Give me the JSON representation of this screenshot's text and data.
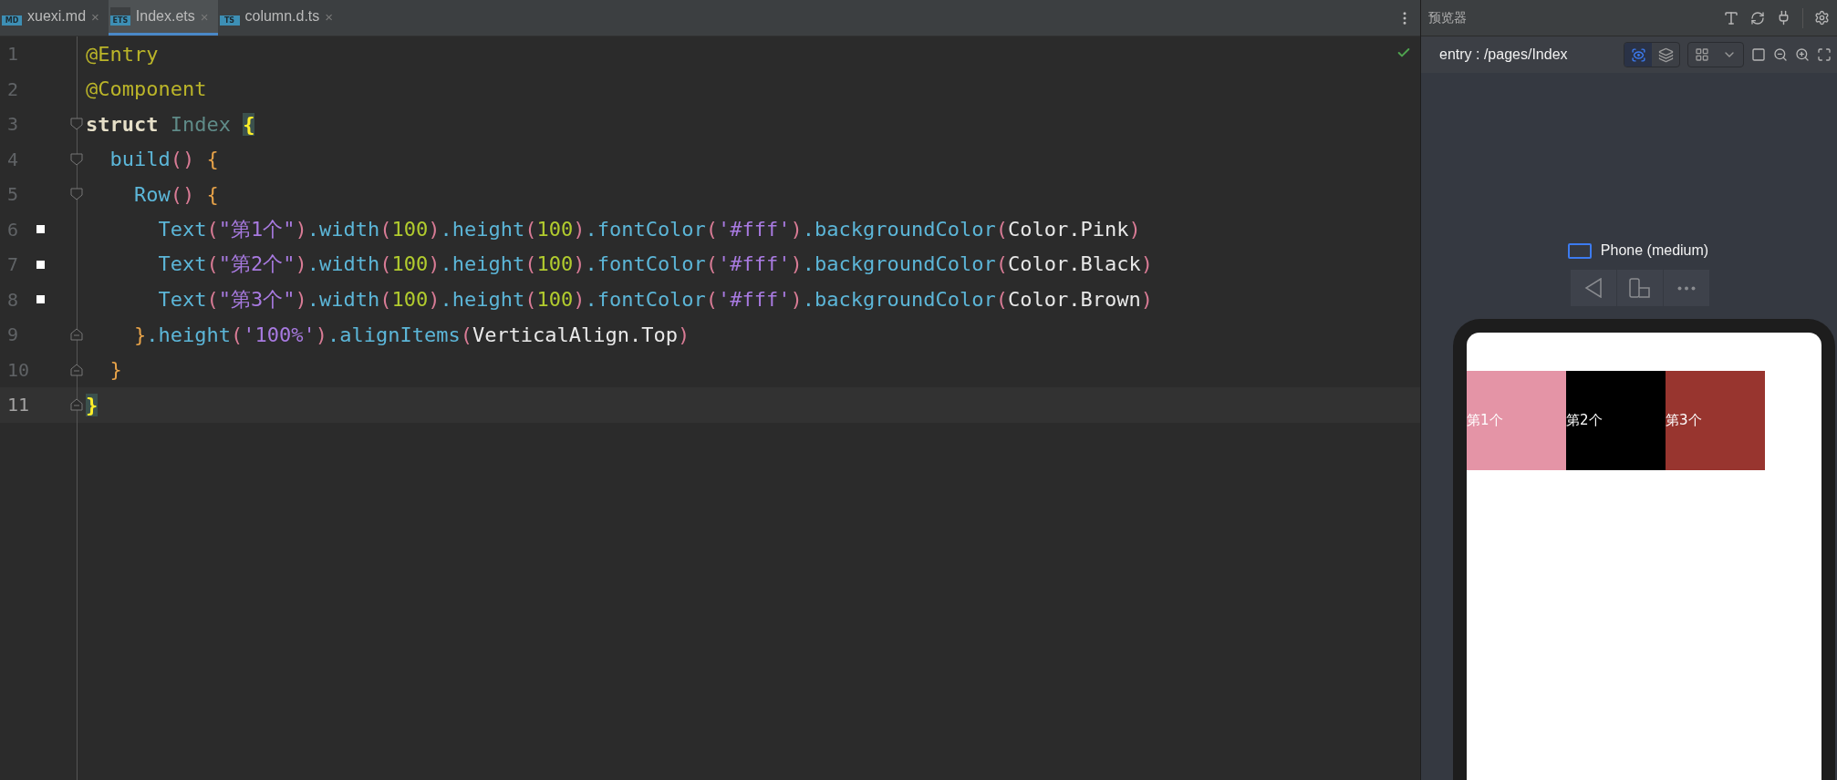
{
  "tabs": [
    {
      "label": "xuexi.md",
      "icon_label": "MD",
      "close": "×",
      "selected": false
    },
    {
      "label": "Index.ets",
      "icon_label": "ETS",
      "close": "×",
      "selected": true
    },
    {
      "label": "column.d.ts",
      "icon_label": "TS",
      "close": "×",
      "selected": false
    }
  ],
  "editor": {
    "lines": [
      {
        "number": "1",
        "changed": false,
        "kind": "plain",
        "current": false,
        "tokens": [
          {
            "kind": "annotation",
            "text": "@Entry"
          }
        ]
      },
      {
        "number": "2",
        "changed": false,
        "kind": "plain",
        "current": false,
        "tokens": [
          {
            "kind": "annotation",
            "text": "@Component"
          }
        ]
      },
      {
        "number": "3",
        "changed": false,
        "kind": "fold_start",
        "current": false,
        "tokens": [
          {
            "kind": "keyword",
            "text": "struct"
          },
          {
            "kind": "type",
            "text": " Index "
          },
          {
            "kind": "match",
            "text": "{"
          }
        ]
      },
      {
        "number": "4",
        "changed": false,
        "kind": "fold_start",
        "current": false,
        "tokens": [
          {
            "kind": "call",
            "text": "  build"
          },
          {
            "kind": "paren",
            "text": "()"
          },
          {
            "kind": "brace",
            "text": " {"
          }
        ]
      },
      {
        "number": "5",
        "changed": false,
        "kind": "fold_start",
        "current": false,
        "tokens": [
          {
            "kind": "call",
            "text": "    Row"
          },
          {
            "kind": "paren",
            "text": "()"
          },
          {
            "kind": "brace",
            "text": " {"
          }
        ]
      },
      {
        "number": "6",
        "changed": true,
        "kind": "plain",
        "current": false,
        "tokens": [
          {
            "kind": "call",
            "text": "      Text"
          },
          {
            "kind": "paren",
            "text": "("
          },
          {
            "kind": "string",
            "text": "\"第1个\""
          },
          {
            "kind": "paren",
            "text": ")"
          },
          {
            "kind": "call",
            "text": ".width"
          },
          {
            "kind": "paren",
            "text": "("
          },
          {
            "kind": "number",
            "text": "100"
          },
          {
            "kind": "paren",
            "text": ")"
          },
          {
            "kind": "call",
            "text": ".height"
          },
          {
            "kind": "paren",
            "text": "("
          },
          {
            "kind": "number",
            "text": "100"
          },
          {
            "kind": "paren",
            "text": ")"
          },
          {
            "kind": "call",
            "text": ".fontColor"
          },
          {
            "kind": "paren",
            "text": "("
          },
          {
            "kind": "string",
            "text": "'#fff'"
          },
          {
            "kind": "paren",
            "text": ")"
          },
          {
            "kind": "call",
            "text": ".backgroundColor"
          },
          {
            "kind": "paren",
            "text": "("
          },
          {
            "kind": "plain",
            "text": "Color.Pink"
          },
          {
            "kind": "paren",
            "text": ")"
          }
        ]
      },
      {
        "number": "7",
        "changed": true,
        "kind": "plain",
        "current": false,
        "tokens": [
          {
            "kind": "call",
            "text": "      Text"
          },
          {
            "kind": "paren",
            "text": "("
          },
          {
            "kind": "string",
            "text": "\"第2个\""
          },
          {
            "kind": "paren",
            "text": ")"
          },
          {
            "kind": "call",
            "text": ".width"
          },
          {
            "kind": "paren",
            "text": "("
          },
          {
            "kind": "number",
            "text": "100"
          },
          {
            "kind": "paren",
            "text": ")"
          },
          {
            "kind": "call",
            "text": ".height"
          },
          {
            "kind": "paren",
            "text": "("
          },
          {
            "kind": "number",
            "text": "100"
          },
          {
            "kind": "paren",
            "text": ")"
          },
          {
            "kind": "call",
            "text": ".fontColor"
          },
          {
            "kind": "paren",
            "text": "("
          },
          {
            "kind": "string",
            "text": "'#fff'"
          },
          {
            "kind": "paren",
            "text": ")"
          },
          {
            "kind": "call",
            "text": ".backgroundColor"
          },
          {
            "kind": "paren",
            "text": "("
          },
          {
            "kind": "plain",
            "text": "Color.Black"
          },
          {
            "kind": "paren",
            "text": ")"
          }
        ]
      },
      {
        "number": "8",
        "changed": true,
        "kind": "plain",
        "current": false,
        "tokens": [
          {
            "kind": "call",
            "text": "      Text"
          },
          {
            "kind": "paren",
            "text": "("
          },
          {
            "kind": "string",
            "text": "\"第3个\""
          },
          {
            "kind": "paren",
            "text": ")"
          },
          {
            "kind": "call",
            "text": ".width"
          },
          {
            "kind": "paren",
            "text": "("
          },
          {
            "kind": "number",
            "text": "100"
          },
          {
            "kind": "paren",
            "text": ")"
          },
          {
            "kind": "call",
            "text": ".height"
          },
          {
            "kind": "paren",
            "text": "("
          },
          {
            "kind": "number",
            "text": "100"
          },
          {
            "kind": "paren",
            "text": ")"
          },
          {
            "kind": "call",
            "text": ".fontColor"
          },
          {
            "kind": "paren",
            "text": "("
          },
          {
            "kind": "string",
            "text": "'#fff'"
          },
          {
            "kind": "paren",
            "text": ")"
          },
          {
            "kind": "call",
            "text": ".backgroundColor"
          },
          {
            "kind": "paren",
            "text": "("
          },
          {
            "kind": "plain",
            "text": "Color.Brown"
          },
          {
            "kind": "paren",
            "text": ")"
          }
        ]
      },
      {
        "number": "9",
        "changed": false,
        "kind": "fold_end",
        "current": false,
        "tokens": [
          {
            "kind": "brace",
            "text": "    }"
          },
          {
            "kind": "call",
            "text": ".height"
          },
          {
            "kind": "paren",
            "text": "("
          },
          {
            "kind": "string",
            "text": "'100%'"
          },
          {
            "kind": "paren",
            "text": ")"
          },
          {
            "kind": "call",
            "text": ".alignItems"
          },
          {
            "kind": "paren",
            "text": "("
          },
          {
            "kind": "plain",
            "text": "VerticalAlign.Top"
          },
          {
            "kind": "paren",
            "text": ")"
          }
        ]
      },
      {
        "number": "10",
        "changed": false,
        "kind": "fold_end",
        "current": false,
        "tokens": [
          {
            "kind": "brace",
            "text": "  }"
          }
        ]
      },
      {
        "number": "11",
        "changed": false,
        "kind": "fold_end",
        "current": true,
        "tokens": [
          {
            "kind": "match",
            "text": "}"
          }
        ]
      }
    ]
  },
  "preview": {
    "title": "预览器",
    "route": "entry : /pages/Index",
    "view_toggles": [
      {
        "kind": "inspect",
        "selected": true
      },
      {
        "kind": "layers",
        "selected": false
      }
    ],
    "device": "Phone (medium)",
    "screen_items": [
      {
        "label": "第1个",
        "color": "#e494a6"
      },
      {
        "label": "第2个",
        "color": "#000000"
      },
      {
        "label": "第3个",
        "color": "#98352f"
      }
    ]
  }
}
